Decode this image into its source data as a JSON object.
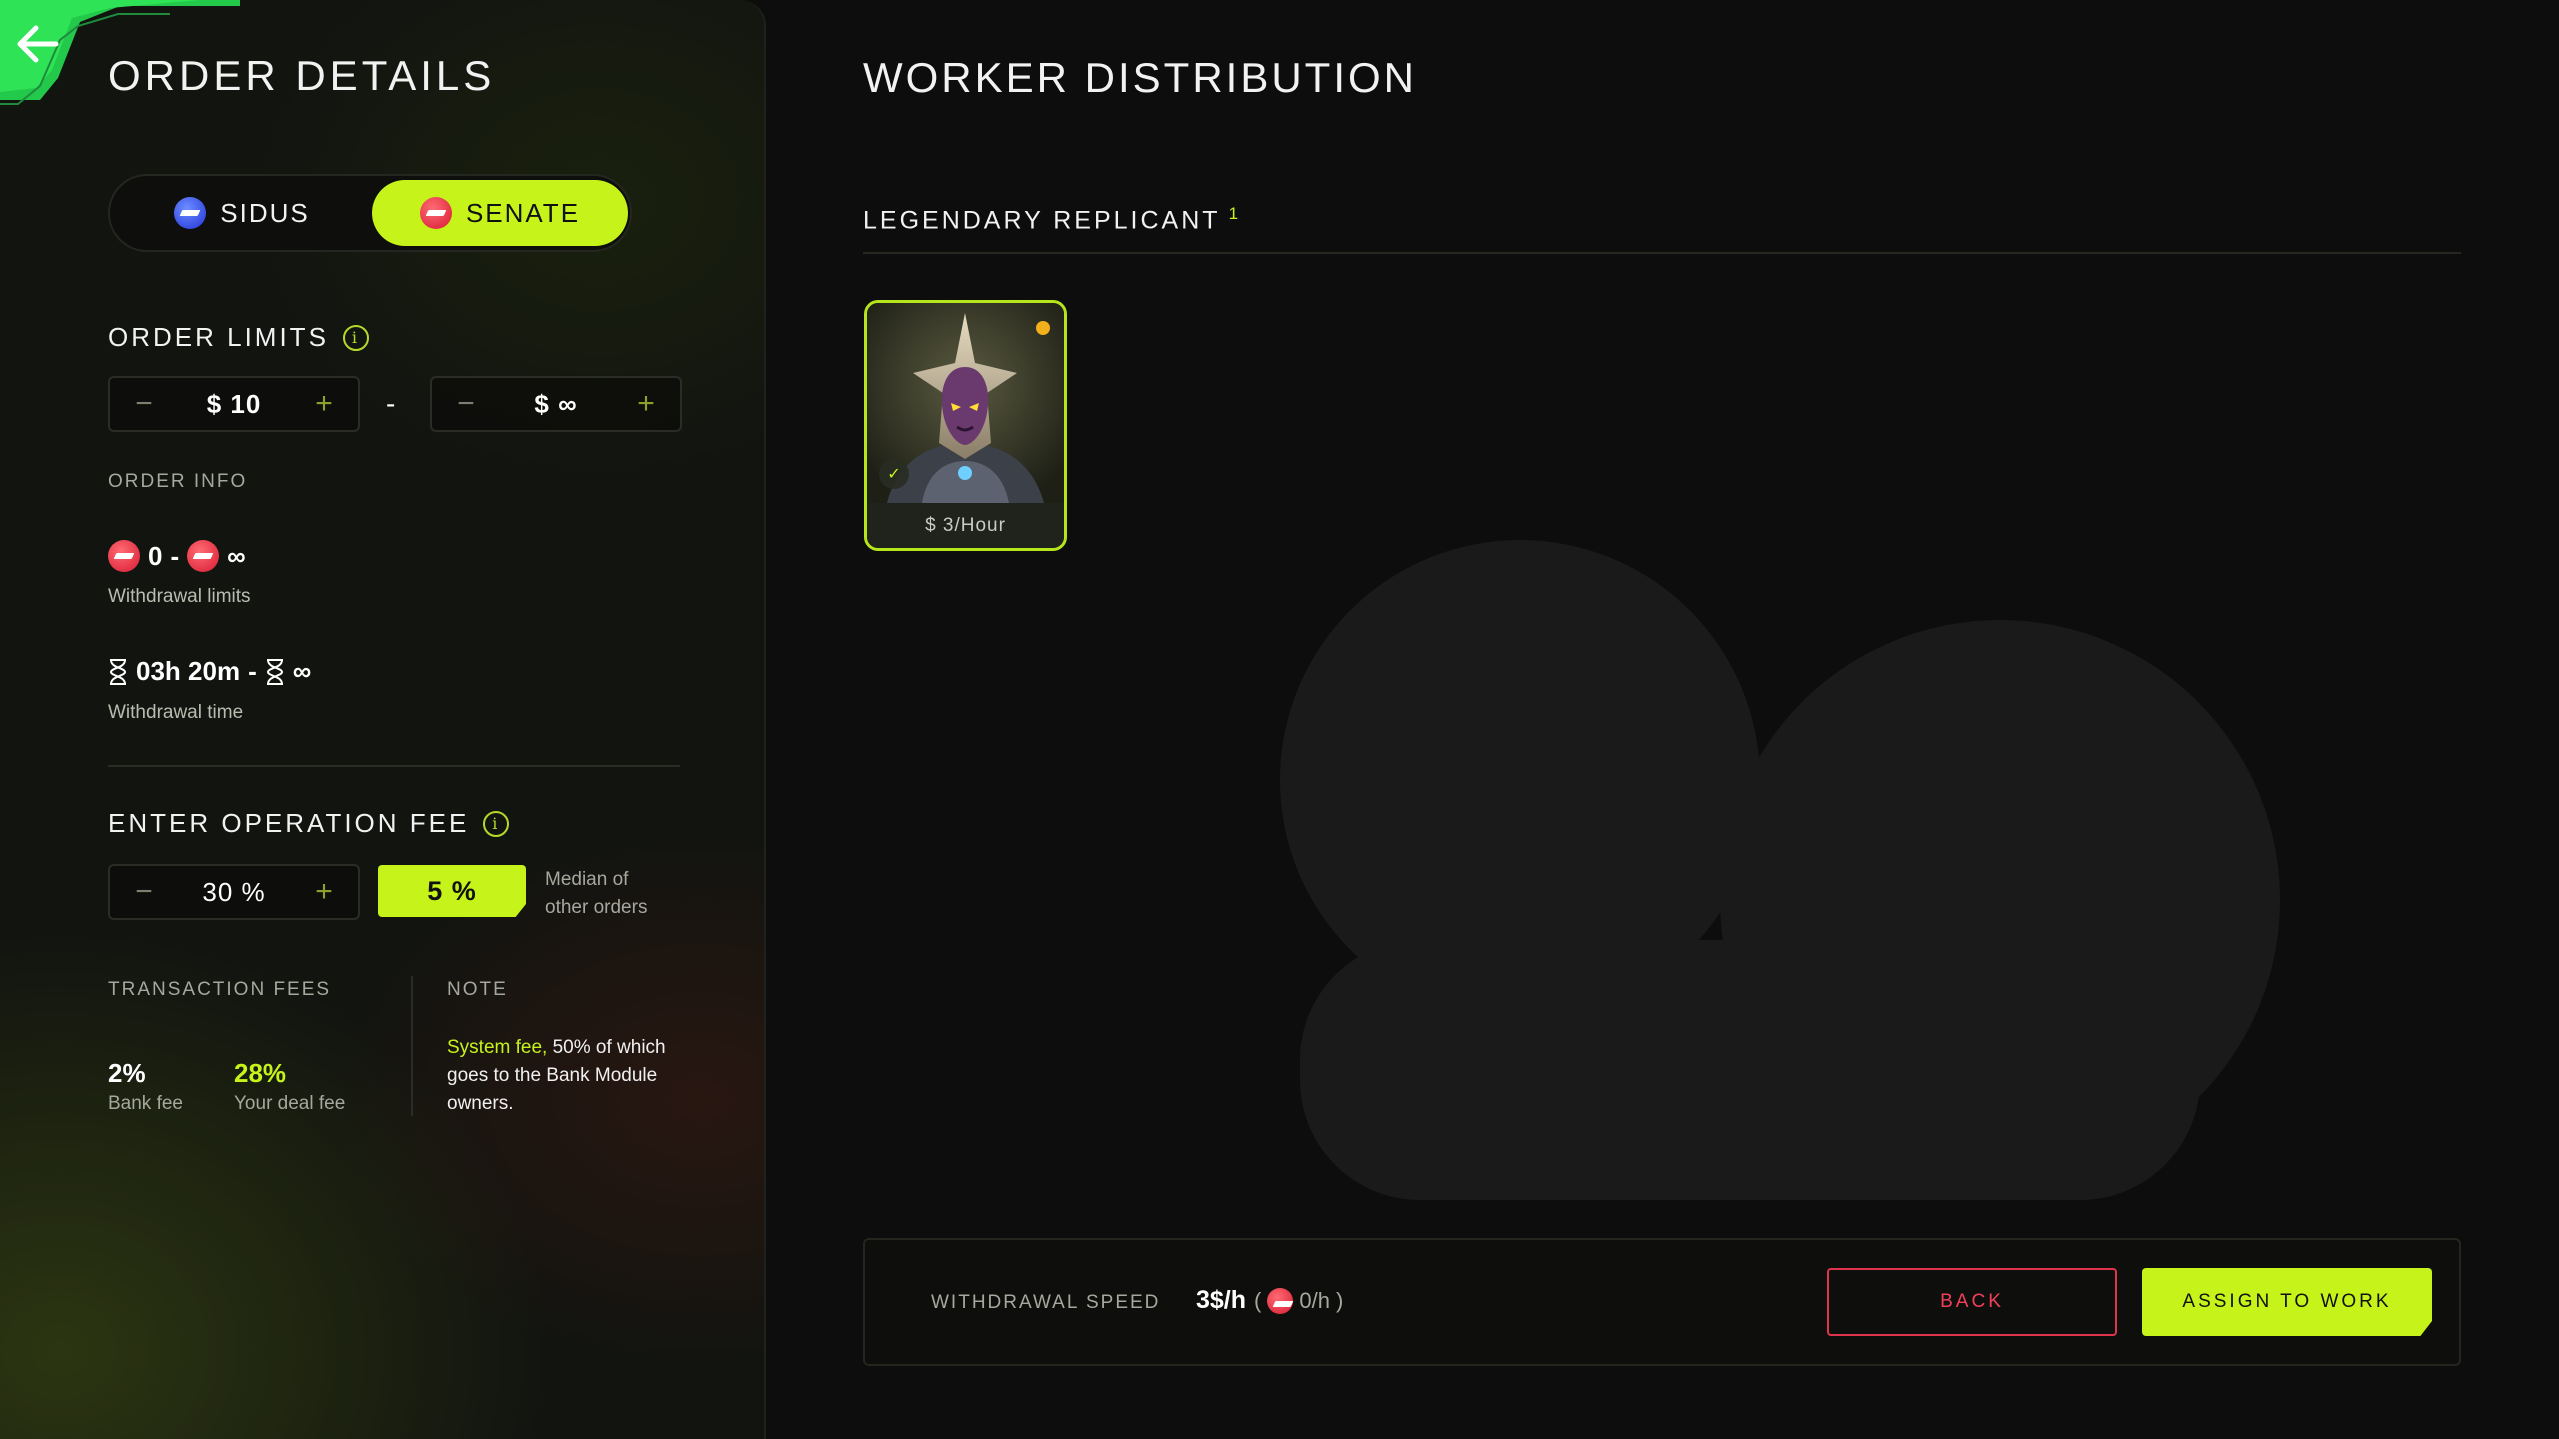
{
  "left": {
    "title": "ORDER DETAILS",
    "toggle": {
      "option1": "SIDUS",
      "option2": "SENATE",
      "selected": "SENATE"
    },
    "order_limits": {
      "title": "ORDER LIMITS",
      "min_value": "$ 10",
      "separator": "-",
      "max_value": "$ ∞"
    },
    "order_info": {
      "title": "ORDER INFO",
      "withdrawal_limits_from": "0",
      "withdrawal_limits_dash": "-",
      "withdrawal_limits_to": "∞",
      "withdrawal_limits_label": "Withdrawal limits",
      "withdrawal_time_from": "03h 20m",
      "withdrawal_time_dash": "-",
      "withdrawal_time_to": "∞",
      "withdrawal_time_label": "Withdrawal time"
    },
    "operation_fee": {
      "title": "ENTER OPERATION FEE",
      "value": "30 %",
      "median_value": "5 %",
      "median_label_line1": "Median of",
      "median_label_line2": "other orders"
    },
    "transaction_fees": {
      "title": "TRANSACTION FEES",
      "bank_fee_value": "2%",
      "bank_fee_label": "Bank fee",
      "deal_fee_value": "28%",
      "deal_fee_label": "Your deal fee"
    },
    "note": {
      "title": "NOTE",
      "highlight": "System fee,",
      "text": " 50% of which goes to the Bank Module owners."
    }
  },
  "right": {
    "title": "WORKER DISTRIBUTION",
    "category": {
      "title": "LEGENDARY REPLICANT",
      "count": "1"
    },
    "workers": [
      {
        "price": "$ 3/Hour",
        "selected": true
      }
    ],
    "bottom_bar": {
      "withdrawal_speed_label": "WITHDRAWAL SPEED",
      "withdrawal_speed_value": "3$/h",
      "withdrawal_speed_token": "0/h",
      "back_label": "BACK",
      "assign_label": "ASSIGN TO WORK"
    }
  },
  "colors": {
    "accent": "#c6f31a",
    "danger": "#e0334e",
    "background": "#0d0d0d"
  }
}
